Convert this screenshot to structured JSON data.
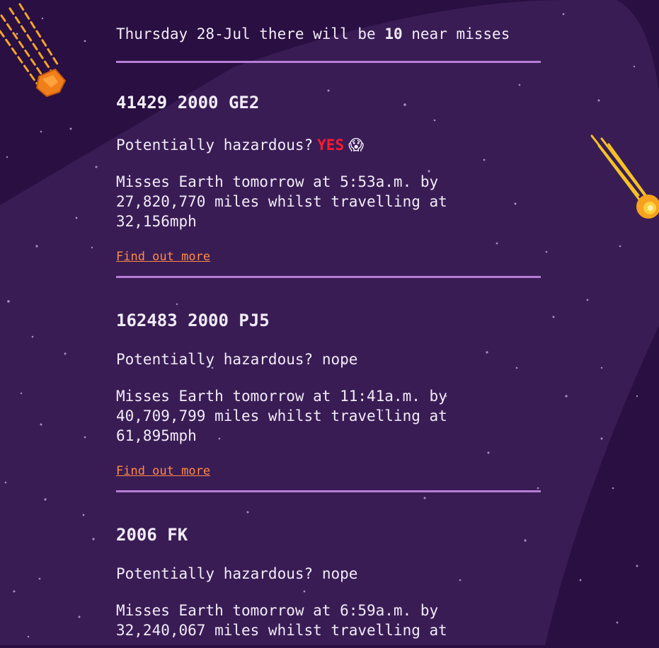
{
  "header": {
    "prefix": "Thursday 28-Jul there will be",
    "count": "10",
    "suffix": "near misses"
  },
  "asteroids": [
    {
      "name": "41429 2000 GE2",
      "hazard_label": "Potentially hazardous?",
      "hazard_value": "YES",
      "hazard_emoji": "😱",
      "miss_text": "Misses Earth tomorrow at 5:53a.m. by 27,820,770 miles whilst travelling at 32,156mph",
      "link": "Find out more"
    },
    {
      "name": "162483 2000 PJ5",
      "hazard_label": "Potentially hazardous?",
      "hazard_value": "nope",
      "miss_text": "Misses Earth tomorrow at 11:41a.m. by 40,709,799 miles whilst travelling at 61,895mph",
      "link": "Find out more"
    },
    {
      "name": "2006 FK",
      "hazard_label": "Potentially hazardous?",
      "hazard_value": "nope",
      "miss_text": "Misses Earth tomorrow at 6:59a.m. by 32,240,067 miles whilst travelling at"
    }
  ],
  "colors": {
    "background": "#2a0f42",
    "band": "#3a1c55",
    "rule": "#b57ed6",
    "link": "#ff8a45",
    "hazard_yes": "#ff1a2f"
  },
  "icons": [
    "meteor-icon-left",
    "meteor-icon-right"
  ]
}
